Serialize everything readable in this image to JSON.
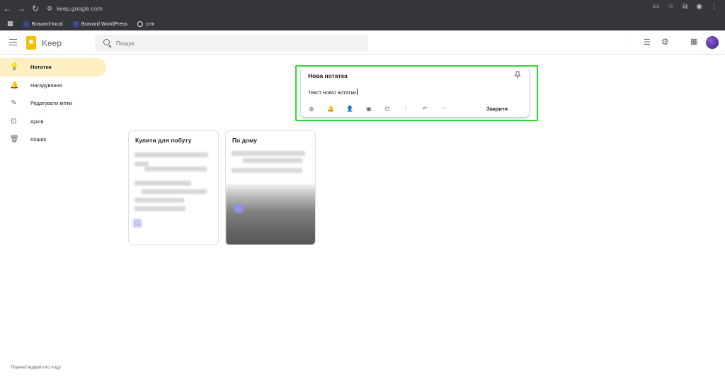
{
  "browser": {
    "url": "keep.google.com",
    "bookmarks": [
      {
        "label": "Bravard-local"
      },
      {
        "label": "Bravard WordPress"
      },
      {
        "label": "crm"
      }
    ]
  },
  "header": {
    "app_title": "Keep",
    "search_placeholder": "Пошук"
  },
  "sidebar": {
    "items": [
      {
        "label": "Нотатки",
        "icon": "lightbulb-icon",
        "active": true
      },
      {
        "label": "Нагадування",
        "icon": "bell-icon",
        "active": false
      },
      {
        "label": "Редагувати мітки",
        "icon": "pencil-icon",
        "active": false
      },
      {
        "label": "Архів",
        "icon": "archive-icon",
        "active": false
      },
      {
        "label": "Кошик",
        "icon": "trash-icon",
        "active": false
      }
    ]
  },
  "editor": {
    "title": "Нова нотатка",
    "text": "Текст нової нотатки",
    "close_label": "Закрити",
    "highlight_color": "#29e02a"
  },
  "notes": [
    {
      "title": "Купити для побуту"
    },
    {
      "title": "По дому"
    }
  ],
  "footer": {
    "license_text": "Ліцензії відкритого коду"
  }
}
